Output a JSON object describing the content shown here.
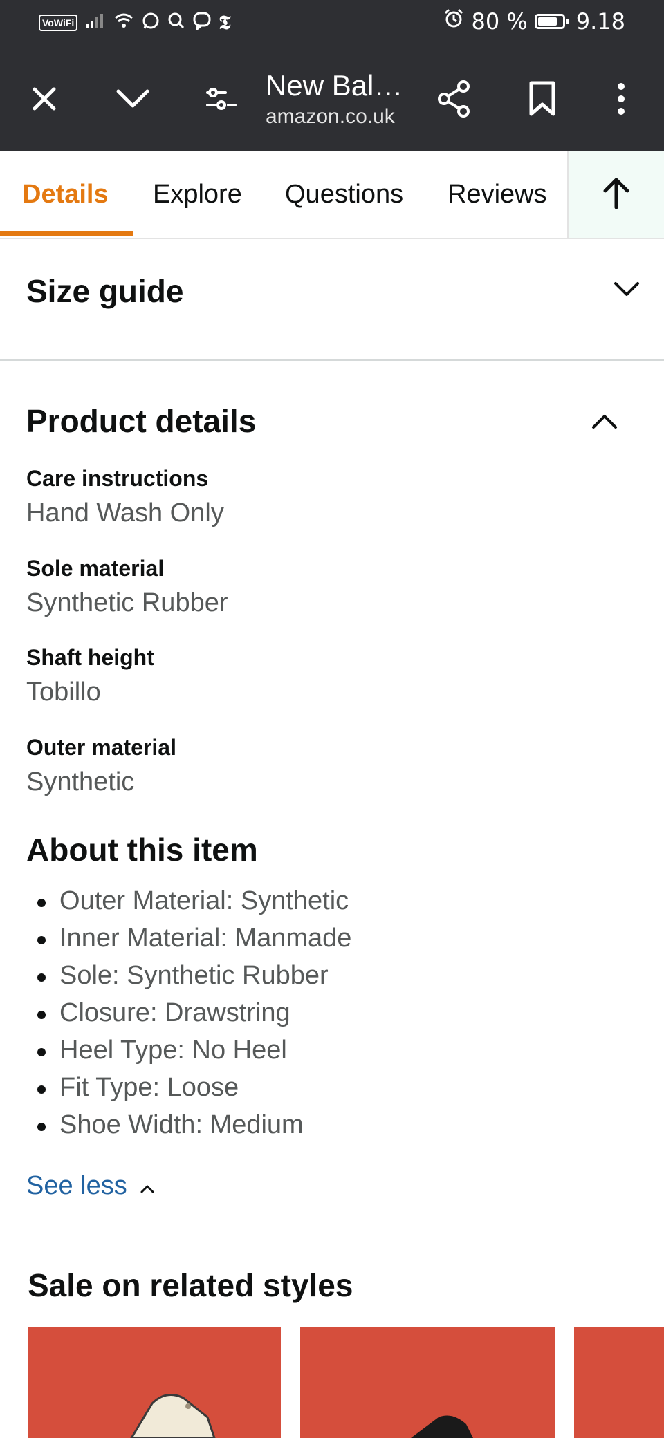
{
  "status_bar": {
    "vowifi": "VoWiFi",
    "battery_text": "80 %",
    "battery_level": 0.8,
    "time": "9.18",
    "icons": [
      "signal-icon",
      "wifi-icon",
      "whatsapp-icon",
      "search-icon",
      "viber-icon",
      "nyt-icon",
      "alarm-icon",
      "battery-icon"
    ]
  },
  "toolbar": {
    "title": "New Bal…",
    "url": "amazon.co.uk",
    "icons": [
      "close-icon",
      "chevron-down-icon",
      "tune-icon",
      "share-icon",
      "bookmark-icon",
      "more-icon"
    ]
  },
  "tabs": [
    {
      "label": "Details",
      "active": true
    },
    {
      "label": "Explore",
      "active": false
    },
    {
      "label": "Questions",
      "active": false
    },
    {
      "label": "Reviews",
      "active": false
    }
  ],
  "size_guide": {
    "label": "Size guide"
  },
  "product_details": {
    "title": "Product details",
    "attributes": [
      {
        "key": "Care instructions",
        "value": "Hand Wash Only"
      },
      {
        "key": "Sole material",
        "value": "Synthetic Rubber"
      },
      {
        "key": "Shaft height",
        "value": "Tobillo"
      },
      {
        "key": "Outer material",
        "value": "Synthetic"
      }
    ]
  },
  "about": {
    "title": "About this item",
    "bullets": [
      "Outer Material: Synthetic",
      "Inner Material: Manmade",
      "Sole: Synthetic Rubber",
      "Closure: Drawstring",
      "Heel Type: No Heel",
      "Fit Type: Loose",
      "Shoe Width: Medium"
    ],
    "see_less": "See less"
  },
  "related": {
    "title": "Sale on related styles",
    "card_color": "#d54e3c"
  },
  "colors": {
    "accent": "#e47911",
    "link": "#2162a1",
    "bar": "#2e2f33"
  }
}
